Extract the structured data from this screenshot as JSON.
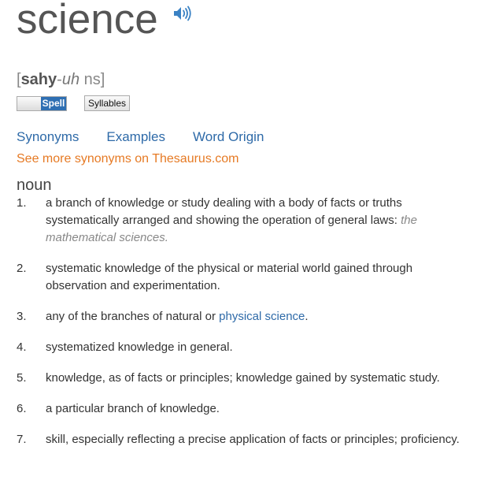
{
  "headword": "science",
  "audio_icon": "speaker-icon",
  "pronunciation": {
    "open": "[",
    "stress": "sahy",
    "sep": "-",
    "ital": "uh",
    "rest": " ns",
    "close": "]"
  },
  "buttons": {
    "spell": "Spell",
    "syllables": "Syllables"
  },
  "tabs": [
    "Synonyms",
    "Examples",
    "Word Origin"
  ],
  "thesaurus_link": "See more synonyms on Thesaurus.com",
  "part_of_speech": "noun",
  "colors": {
    "link": "#2e6aa8",
    "thesaurus": "#e67a24",
    "spell_active": "#2e6fb3"
  },
  "definitions": [
    {
      "num": "1.",
      "text": "a branch of knowledge or study dealing with a body of facts or truths systematically arranged and showing the operation of general laws:",
      "example": "the mathematical sciences."
    },
    {
      "num": "2.",
      "text": "systematic knowledge of the physical or material world gained through observation and experimentation."
    },
    {
      "num": "3.",
      "text_before": "any of the branches of natural or",
      "link": "physical science",
      "text_after": "."
    },
    {
      "num": "4.",
      "text": "systematized knowledge in general."
    },
    {
      "num": "5.",
      "text": "knowledge, as of facts or principles; knowledge gained by systematic study."
    },
    {
      "num": "6.",
      "text": "a particular branch of knowledge."
    },
    {
      "num": "7.",
      "text": "skill, especially reflecting a precise application of facts or principles; proficiency."
    }
  ]
}
